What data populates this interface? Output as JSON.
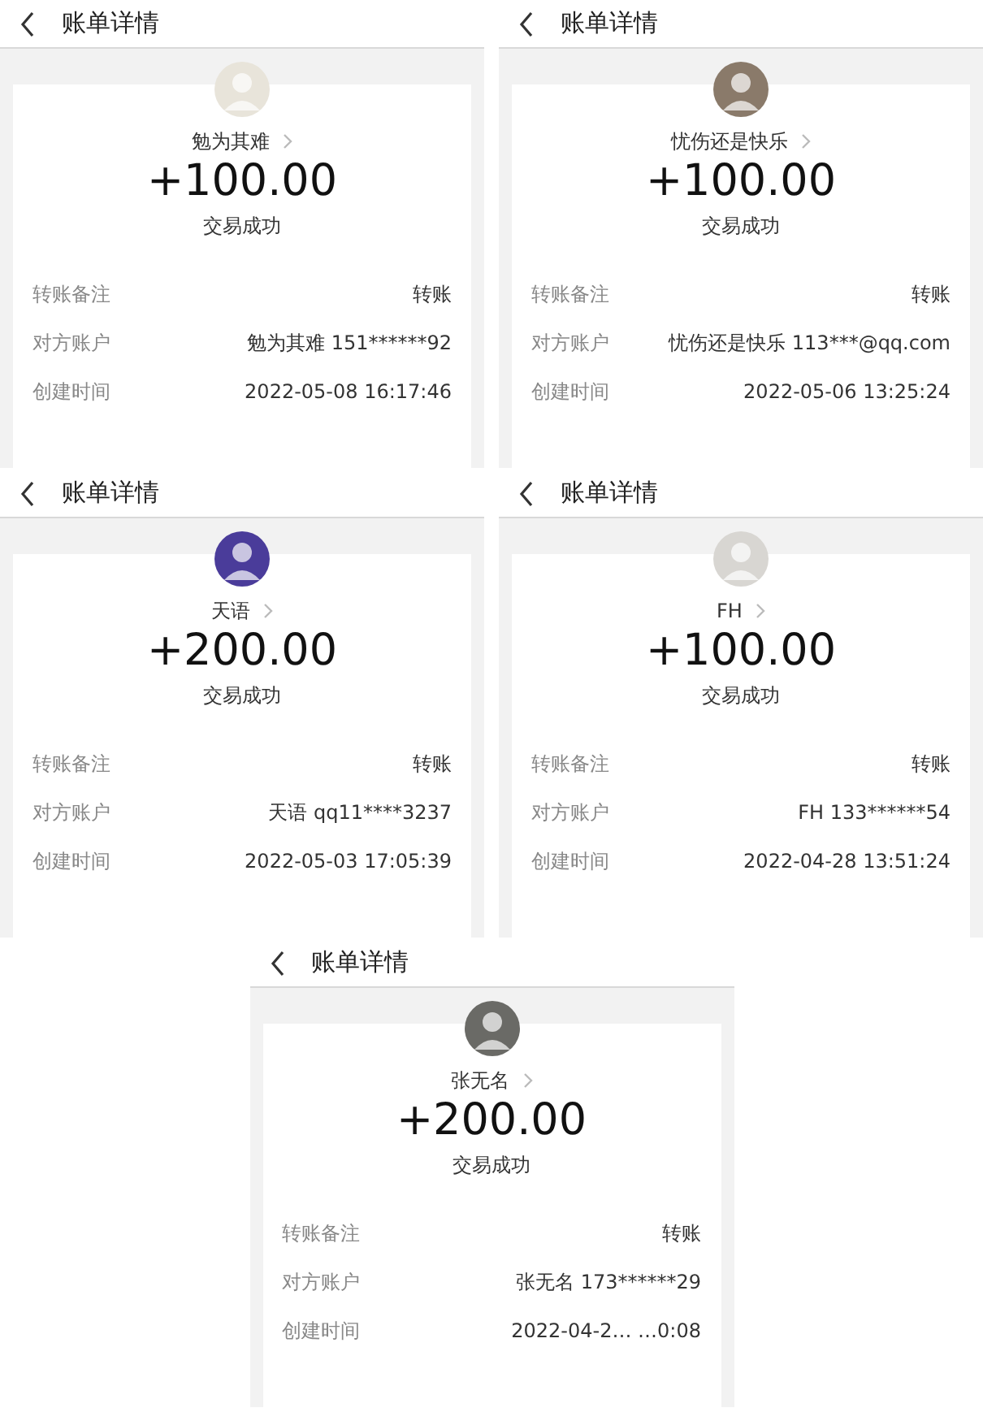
{
  "panels": [
    {
      "title": "账单详情",
      "color": "#e8e4da",
      "name": "勉为其难",
      "amount": "+100.00",
      "status": "交易成功",
      "rows": [
        {
          "label": "转账备注",
          "value": "转账"
        },
        {
          "label": "对方账户",
          "value": "勉为其难 151******92"
        },
        {
          "label": "创建时间",
          "value": "2022-05-08 16:17:46"
        }
      ]
    },
    {
      "title": "账单详情",
      "color": "#8a7a6a",
      "name": "忧伤还是快乐",
      "amount": "+100.00",
      "status": "交易成功",
      "rows": [
        {
          "label": "转账备注",
          "value": "转账"
        },
        {
          "label": "对方账户",
          "value": "忧伤还是快乐 113***@qq.com"
        },
        {
          "label": "创建时间",
          "value": "2022-05-06 13:25:24"
        }
      ]
    },
    {
      "title": "账单详情",
      "color": "#4a3c9a",
      "name": "天语",
      "amount": "+200.00",
      "status": "交易成功",
      "rows": [
        {
          "label": "转账备注",
          "value": "转账"
        },
        {
          "label": "对方账户",
          "value": "天语 qq11****3237"
        },
        {
          "label": "创建时间",
          "value": "2022-05-03 17:05:39"
        }
      ]
    },
    {
      "title": "账单详情",
      "color": "#d8d6d2",
      "name": "FH",
      "amount": "+100.00",
      "status": "交易成功",
      "rows": [
        {
          "label": "转账备注",
          "value": "转账"
        },
        {
          "label": "对方账户",
          "value": "FH 133******54"
        },
        {
          "label": "创建时间",
          "value": "2022-04-28 13:51:24"
        }
      ]
    },
    {
      "title": "账单详情",
      "color": "#6a6a66",
      "name": "张无名",
      "amount": "+200.00",
      "status": "交易成功",
      "rows": [
        {
          "label": "转账备注",
          "value": "转账"
        },
        {
          "label": "对方账户",
          "value": "张无名 173******29"
        },
        {
          "label": "创建时间",
          "value": "2022-04-2… …0:08"
        }
      ]
    }
  ]
}
